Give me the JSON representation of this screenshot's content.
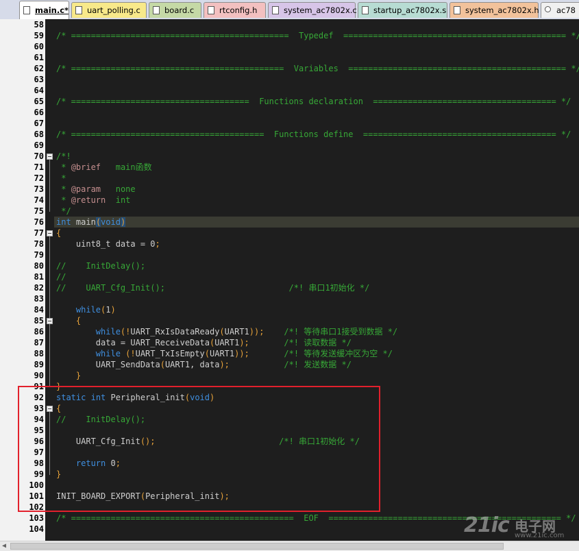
{
  "tabs": [
    {
      "label": "main.c*",
      "active": true,
      "color": "#ffffff"
    },
    {
      "label": "uart_polling.c",
      "active": false,
      "color": "#f8e98a"
    },
    {
      "label": "board.c",
      "active": false,
      "color": "#c5d9a6"
    },
    {
      "label": "rtconfig.h",
      "active": false,
      "color": "#f3c0c0"
    },
    {
      "label": "system_ac7802x.c",
      "active": false,
      "color": "#d7c5e8"
    },
    {
      "label": "startup_ac7802x.s",
      "active": false,
      "color": "#b7dcd3"
    },
    {
      "label": "system_ac7802x.h",
      "active": false,
      "color": "#f2c29b"
    },
    {
      "label": "ac78",
      "active": false,
      "color": "#f0f0f0"
    }
  ],
  "lines": {
    "l58": "58",
    "l59": "59",
    "l60": "60",
    "l61": "61",
    "l62": "62",
    "l63": "63",
    "l64": "64",
    "l65": "65",
    "l66": "66",
    "l67": "67",
    "l68": "68",
    "l69": "69",
    "l70": "70",
    "l71": "71",
    "l72": "72",
    "l73": "73",
    "l74": "74",
    "l75": "75",
    "l76": "76",
    "l77": "77",
    "l78": "78",
    "l79": "79",
    "l80": "80",
    "l81": "81",
    "l82": "82",
    "l83": "83",
    "l84": "84",
    "l85": "85",
    "l86": "86",
    "l87": "87",
    "l88": "88",
    "l89": "89",
    "l90": "90",
    "l91": "91",
    "l92": "92",
    "l93": "93",
    "l94": "94",
    "l95": "95",
    "l96": "96",
    "l97": "97",
    "l98": "98",
    "l99": "99",
    "l100": "100",
    "l101": "101",
    "l102": "102",
    "l103": "103",
    "l104": "104"
  },
  "code": {
    "c59": "/* ============================================  Typedef  ============================================= */",
    "c62": "/* ===========================================  Variables  ============================================ */",
    "c65": "/* ====================================  Functions declaration  ===================================== */",
    "c68": "/* =======================================  Functions define  ======================================= */",
    "c70": "/*!",
    "c71a": " * ",
    "c71b": "@brief",
    "c71c": "   main函数",
    "c72": " *",
    "c73a": " * ",
    "c73b": "@param",
    "c73c": "   none",
    "c74a": " * ",
    "c74b": "@return",
    "c74c": "  int",
    "c75": " */",
    "c76a": "int",
    "c76b": " main",
    "c76c": "(",
    "c76d": "void",
    "c76e": ")",
    "c77": "{",
    "c78a": "    uint8_t data = ",
    "c78b": "0",
    ";": ";",
    "c78c": ";",
    "c80": "//    InitDelay();",
    "c81": "//",
    "c82": "//    UART_Cfg_Init();                         /*! 串口1初始化 */",
    "c84a": "    ",
    "c84b": "while",
    "c84c": "(",
    "c84d": "1",
    "c84e": ")",
    "c85": "    {",
    "c86a": "        ",
    "c86b": "while",
    "c86c": "(!",
    "c86d": "UART_RxIsDataReady",
    "c86e": "(",
    "c86f": "UART1",
    "c86g": "));",
    "c86h": "    /*! 等待串口1接受到数据 */",
    "c87a": "        data = ",
    "c87b": "UART_ReceiveData",
    "c87c": "(",
    "c87d": "UART1",
    "c87e": ");",
    "c87f": "       /*! 读取数据 */",
    "c88a": "        ",
    "c88b": "while",
    "c88c": " (!",
    "c88d": "UART_TxIsEmpty",
    "c88e": "(",
    "c88f": "UART1",
    "c88g": "));",
    "c88h": "       /*! 等待发送缓冲区为空 */",
    "c89a": "        ",
    "c89b": "UART_SendData",
    "c89c": "(",
    "c89d": "UART1, data",
    "c89e": ");",
    "c89f": "           /*! 发送数据 */",
    "c90": "    }",
    "c91": "}",
    "c92a": "static",
    "c92b": " ",
    "c92c": "int",
    "c92d": " Peripheral_init",
    "c92e": "(",
    "c92f": "void",
    "c92g": ")",
    "c93": "{",
    "c94": "//    InitDelay();",
    "c96a": "    UART_Cfg_Init",
    "c96b": "();",
    "c96c": "                         /*! 串口1初始化 */",
    "c98a": "    ",
    "c98b": "return",
    "c98c": " ",
    "c98d": "0",
    "c98e": ";",
    "c99": "}",
    "c101a": "INIT_BOARD_EXPORT",
    "c101b": "(",
    "c101c": "Peripheral_init",
    "c101d": ");",
    "c103": "/* =============================================  EOF  =============================================== */"
  },
  "watermark": {
    "main": "21ic",
    "cn": "电子网",
    "url": "www.21ic.com"
  },
  "colors": {
    "comment": "#37a837",
    "keyword": "#3f8fe0",
    "bracket": "#e8a33a",
    "highlight_box": "#e2202c",
    "background": "#1e1e1e"
  }
}
